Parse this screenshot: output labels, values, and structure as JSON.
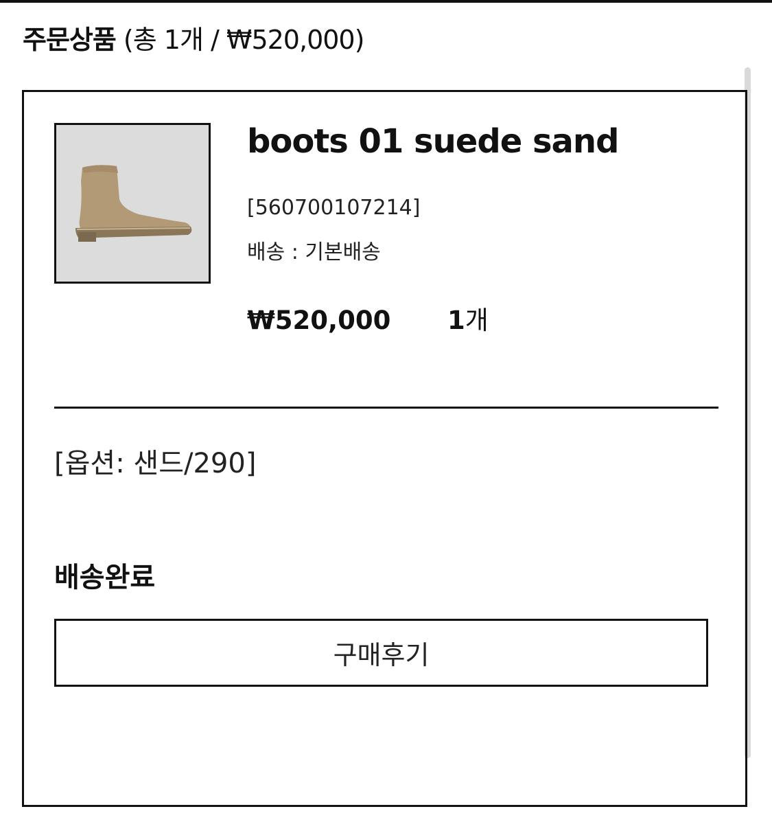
{
  "header": {
    "title": "주문상품",
    "summary": " (총 1개 / ₩520,000)"
  },
  "product": {
    "name": "boots 01 suede sand",
    "code": "[560700107214]",
    "shipping": "배송 : 기본배송",
    "price": "₩520,000",
    "quantity_number": "1",
    "quantity_unit": "개",
    "image_alt": "boot-image"
  },
  "option": "[옵션: 샌드/290]",
  "status": "배송완료",
  "review_button_label": "구매후기",
  "colors": {
    "text": "#111111",
    "thumb_bg": "#dcdcdc",
    "boot": "#b39a76"
  }
}
